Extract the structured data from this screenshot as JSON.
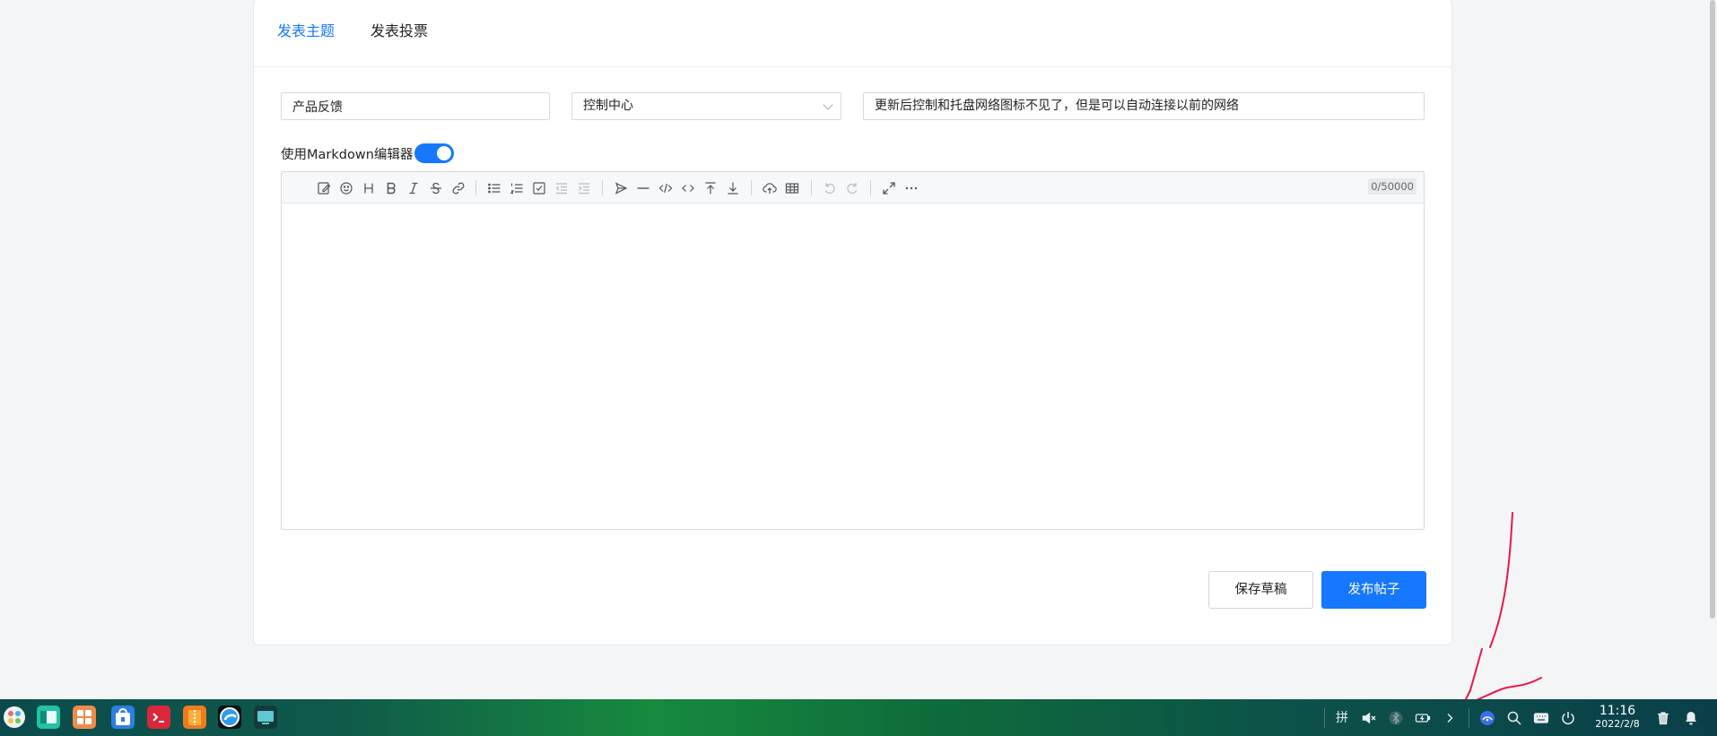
{
  "tabs": [
    {
      "label": "发表主题",
      "active": true
    },
    {
      "label": "发表投票",
      "active": false
    }
  ],
  "form": {
    "category_value": "产品反馈",
    "module_value": "控制中心",
    "title_value": "更新后控制和托盘网络图标不见了，但是可以自动连接以前的网络",
    "markdown_label": "使用Markdown编辑器",
    "markdown_enabled": true
  },
  "editor": {
    "counter": "0/50000",
    "tools": [
      "edit-icon",
      "emoji-icon",
      "heading-icon",
      "bold-icon",
      "italic-icon",
      "strike-icon",
      "link-icon",
      "bullet-list-icon",
      "ordered-list-icon",
      "checklist-icon",
      "outdent-icon",
      "indent-icon",
      "quote-icon",
      "hr-icon",
      "code-icon",
      "inline-code-icon",
      "insert-before-icon",
      "insert-after-icon",
      "upload-icon",
      "table-icon",
      "undo-icon",
      "redo-icon",
      "fullscreen-icon",
      "more-icon"
    ]
  },
  "buttons": {
    "save_draft": "保存草稿",
    "publish": "发布帖子"
  },
  "taskbar": {
    "time": "11:16",
    "date": "2022/2/8",
    "input_method": "拼"
  },
  "colors": {
    "accent": "#1677ff",
    "annotation": "#e8174a"
  }
}
